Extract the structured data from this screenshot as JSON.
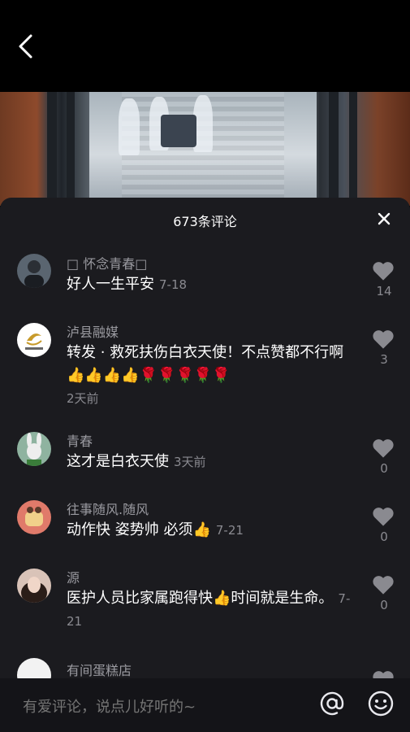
{
  "header": {
    "back_icon": "chevron-left-icon"
  },
  "sheet": {
    "title": "673条评论",
    "close_icon": "close-icon"
  },
  "comments": [
    {
      "user": "□ 怀念青春□",
      "text": "好人一生平安",
      "date": "7-18",
      "likes": "14",
      "avatar_color": "#5a6570"
    },
    {
      "user": "泸县融媒",
      "text": "转发 · 救死扶伤白衣天使！不点赞都不行啊",
      "emojis": "👍👍👍👍🌹🌹🌹🌹🌹",
      "date": "2天前",
      "likes": "3",
      "avatar_color": "#ffffff"
    },
    {
      "user": "青春",
      "text": "这才是白衣天使",
      "date": "3天前",
      "likes": "0",
      "avatar_color": "#8fb3a0"
    },
    {
      "user": "往事随风.随风",
      "text": "动作快 姿势帅 必须",
      "emojis": "👍",
      "date": "7-21",
      "likes": "0",
      "avatar_color": "#e07a6a"
    },
    {
      "user": "源",
      "text": "医护人员比家属跑得快",
      "emojis": "👍",
      "text2": "时间就是生命。",
      "date": "7-21",
      "likes": "0",
      "avatar_color": "#d9c3b8"
    },
    {
      "user": "有间蛋糕店",
      "likes": "",
      "avatar_color": "#f2f2f2"
    }
  ],
  "input": {
    "placeholder": "有爱评论，说点儿好听的~",
    "at_icon": "at-icon",
    "emoji_icon": "smiley-icon"
  },
  "colors": {
    "sheet_bg": "#1b1b1f",
    "muted_text": "#9a9aa0",
    "like_icon": "#8a8a90"
  }
}
